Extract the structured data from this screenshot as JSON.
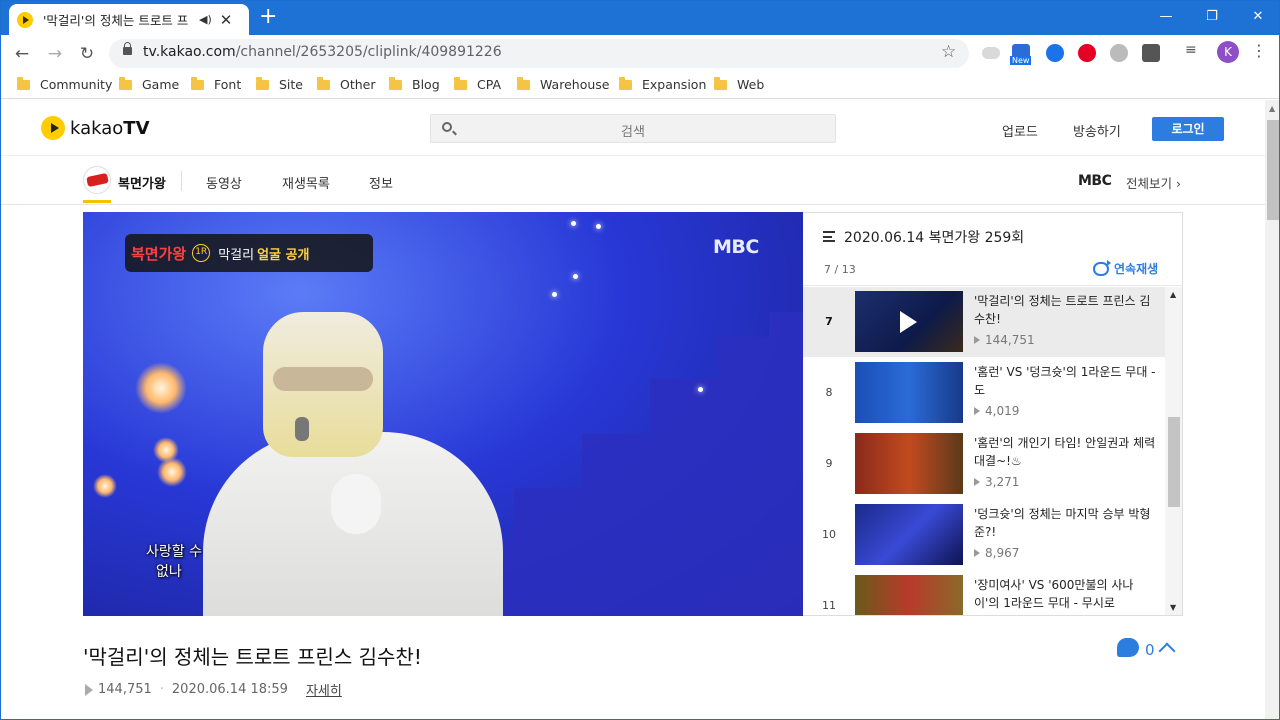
{
  "browser": {
    "tab_title": "'막걸리'의 정체는 트로트 프",
    "url_host": "tv.kakao.com",
    "url_path": "/channel/2653205/cliplink/409891226",
    "bookmarks": [
      "Community",
      "Game",
      "Font",
      "Site",
      "Other",
      "Blog",
      "CPA",
      "Warehouse",
      "Expansion",
      "Web"
    ],
    "profile_initial": "K",
    "ext_new_badge": "New"
  },
  "header": {
    "logo_prefix": "kakao",
    "logo_suffix": "TV",
    "search_placeholder": "검색",
    "upload": "업로드",
    "broadcast": "방송하기",
    "login": "로그인"
  },
  "channel": {
    "name": "복면가왕",
    "tabs": [
      "동영상",
      "재생목록",
      "정보"
    ],
    "network": "MBC",
    "view_all": "전체보기"
  },
  "video": {
    "banner_show": "복면가왕",
    "banner_round": "1R",
    "banner_name": "막걸리",
    "banner_face": "얼굴 공개",
    "watermark": "MBC",
    "subtitle_line1": "사랑할 수",
    "subtitle_line2": "없나"
  },
  "playlist": {
    "title": "2020.06.14 복면가왕 259회",
    "counter": "7 / 13",
    "autoplay": "연속재생",
    "items": [
      {
        "num": "7",
        "title": "'막걸리'의 정체는 트로트 프린스 김수찬!",
        "views": "144,751",
        "active": true
      },
      {
        "num": "8",
        "title": "'홈런' VS '덩크슛'의 1라운드 무대 - 도",
        "views": "4,019",
        "active": false
      },
      {
        "num": "9",
        "title": "'홈런'의 개인기 타임! 안일권과 체력 대결~!♨",
        "views": "3,271",
        "active": false
      },
      {
        "num": "10",
        "title": "'덩크슛'의 정체는 마지막 승부 박형준?!",
        "views": "8,967",
        "active": false
      },
      {
        "num": "11",
        "title": "'장미여사' VS '600만불의 사나이'의 1라운드 무대 - 무시로",
        "views": "",
        "active": false
      }
    ]
  },
  "clip": {
    "title": "'막걸리'의 정체는 트로트 프린스 김수찬!",
    "views": "144,751",
    "date": "2020.06.14 18:59",
    "detail": "자세히",
    "comment_count": "0"
  },
  "colors": {
    "accent": "#2d7de0",
    "kakao_yellow": "#ffcd00",
    "browser_blue": "#1e72d6"
  }
}
